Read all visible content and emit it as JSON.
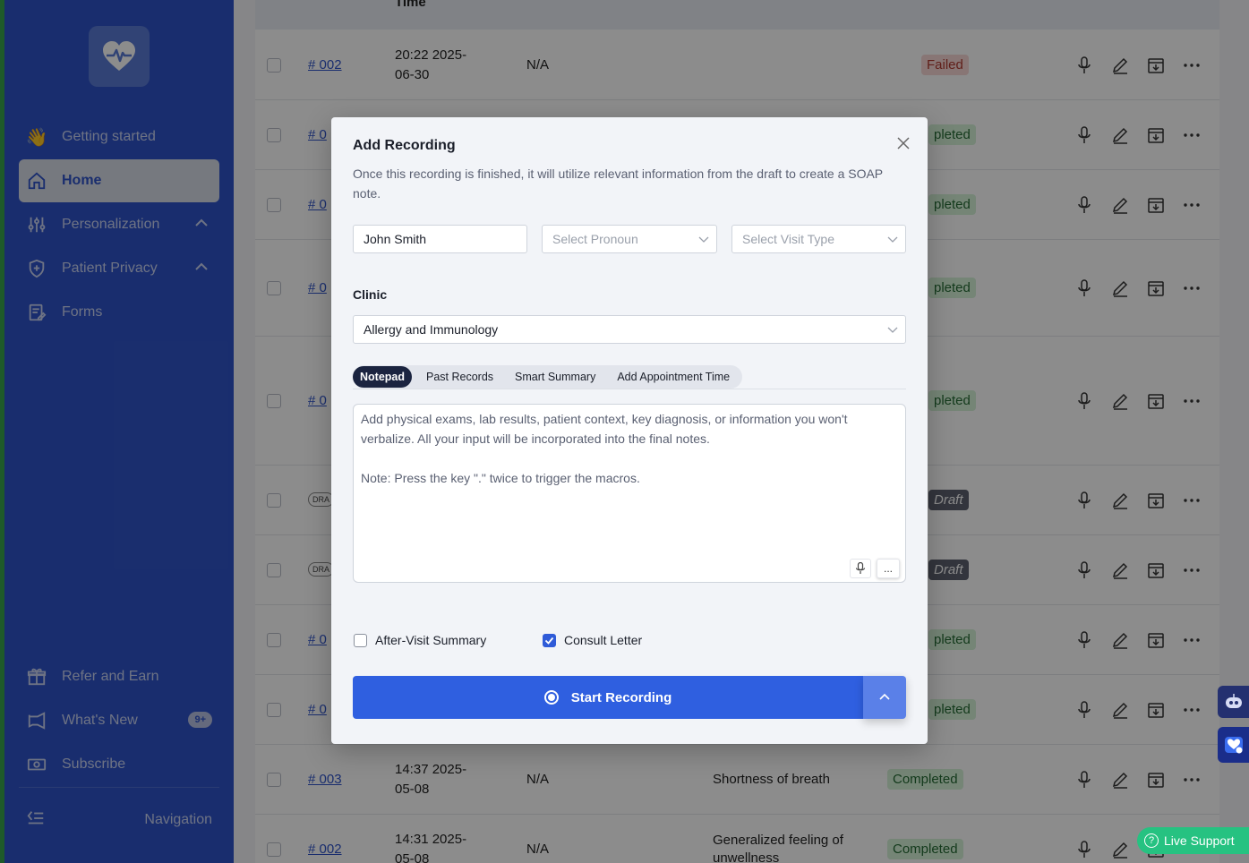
{
  "sidebar": {
    "items": [
      {
        "label": "Getting started",
        "icon": "waving-hand-icon"
      },
      {
        "label": "Home",
        "icon": "home-icon",
        "active": true
      },
      {
        "label": "Personalization",
        "icon": "sliders-icon"
      },
      {
        "label": "Patient Privacy",
        "icon": "shield-plus-icon"
      },
      {
        "label": "Forms",
        "icon": "form-icon"
      }
    ],
    "bottom_items": [
      {
        "label": "Refer and Earn",
        "icon": "gift-icon"
      },
      {
        "label": "What's New",
        "icon": "megaphone-icon",
        "badge": "9+"
      },
      {
        "label": "Subscribe",
        "icon": "banknote-icon"
      }
    ],
    "nav_toggle": "Navigation"
  },
  "table": {
    "time_header": "Time",
    "rows": [
      {
        "id": "# 002",
        "time": "20:22 2025-06-30",
        "na": "N/A",
        "complaint": "",
        "status": "Failed"
      },
      {
        "id": "# 0",
        "time": "",
        "na": "",
        "complaint": "",
        "status": "pleted"
      },
      {
        "id": "# 0",
        "time": "",
        "na": "",
        "complaint": "",
        "status": "pleted"
      },
      {
        "id": "# 0",
        "time": "",
        "na": "",
        "complaint": "",
        "status": "pleted"
      },
      {
        "id": "# 0",
        "time": "",
        "na": "",
        "complaint": "",
        "status": "pleted"
      },
      {
        "id": "DRA",
        "time": "",
        "na": "",
        "complaint": "",
        "status": "Draft"
      },
      {
        "id": "DRA",
        "time": "",
        "na": "",
        "complaint": "",
        "status": "Draft"
      },
      {
        "id": "# 0",
        "time": "",
        "na": "",
        "complaint": "",
        "status": "pleted"
      },
      {
        "id": "# 0",
        "time": "",
        "na": "",
        "complaint": "",
        "status": "pleted"
      },
      {
        "id": "# 003",
        "time": "14:37 2025-05-08",
        "na": "N/A",
        "complaint": "Shortness of breath",
        "status": "Completed"
      },
      {
        "id": "# 002",
        "time": "14:31 2025-05-08",
        "na": "N/A",
        "complaint": "Generalized feeling of unwellness",
        "status": "Completed"
      }
    ]
  },
  "modal": {
    "title": "Add Recording",
    "description": "Once this recording is finished, it will utilize relevant information from the draft to create a SOAP note.",
    "patient_name": "John Smith",
    "pronoun_placeholder": "Select Pronoun",
    "visit_type_placeholder": "Select Visit Type",
    "clinic_label": "Clinic",
    "clinic_value": "Allergy and Immunology",
    "tabs": [
      "Notepad",
      "Past Records",
      "Smart Summary",
      "Add Appointment Time"
    ],
    "notepad_placeholder": "Add physical exams, lab results, patient context, key diagnosis, or information you won't verbalize. All your input will be incorporated into the final notes.\n\nNote: Press the key \".\" twice to trigger the macros.",
    "more_label": "...",
    "after_visit_label": "After-Visit Summary",
    "after_visit_checked": false,
    "consult_letter_label": "Consult Letter",
    "consult_letter_checked": true,
    "start_label": "Start Recording"
  },
  "widgets": {
    "live_support": "Live Support",
    "live_support_icon": "?"
  },
  "colors": {
    "sidebar": "#2f53c8",
    "primary": "#2f5fe0",
    "live_support": "#26c281"
  }
}
